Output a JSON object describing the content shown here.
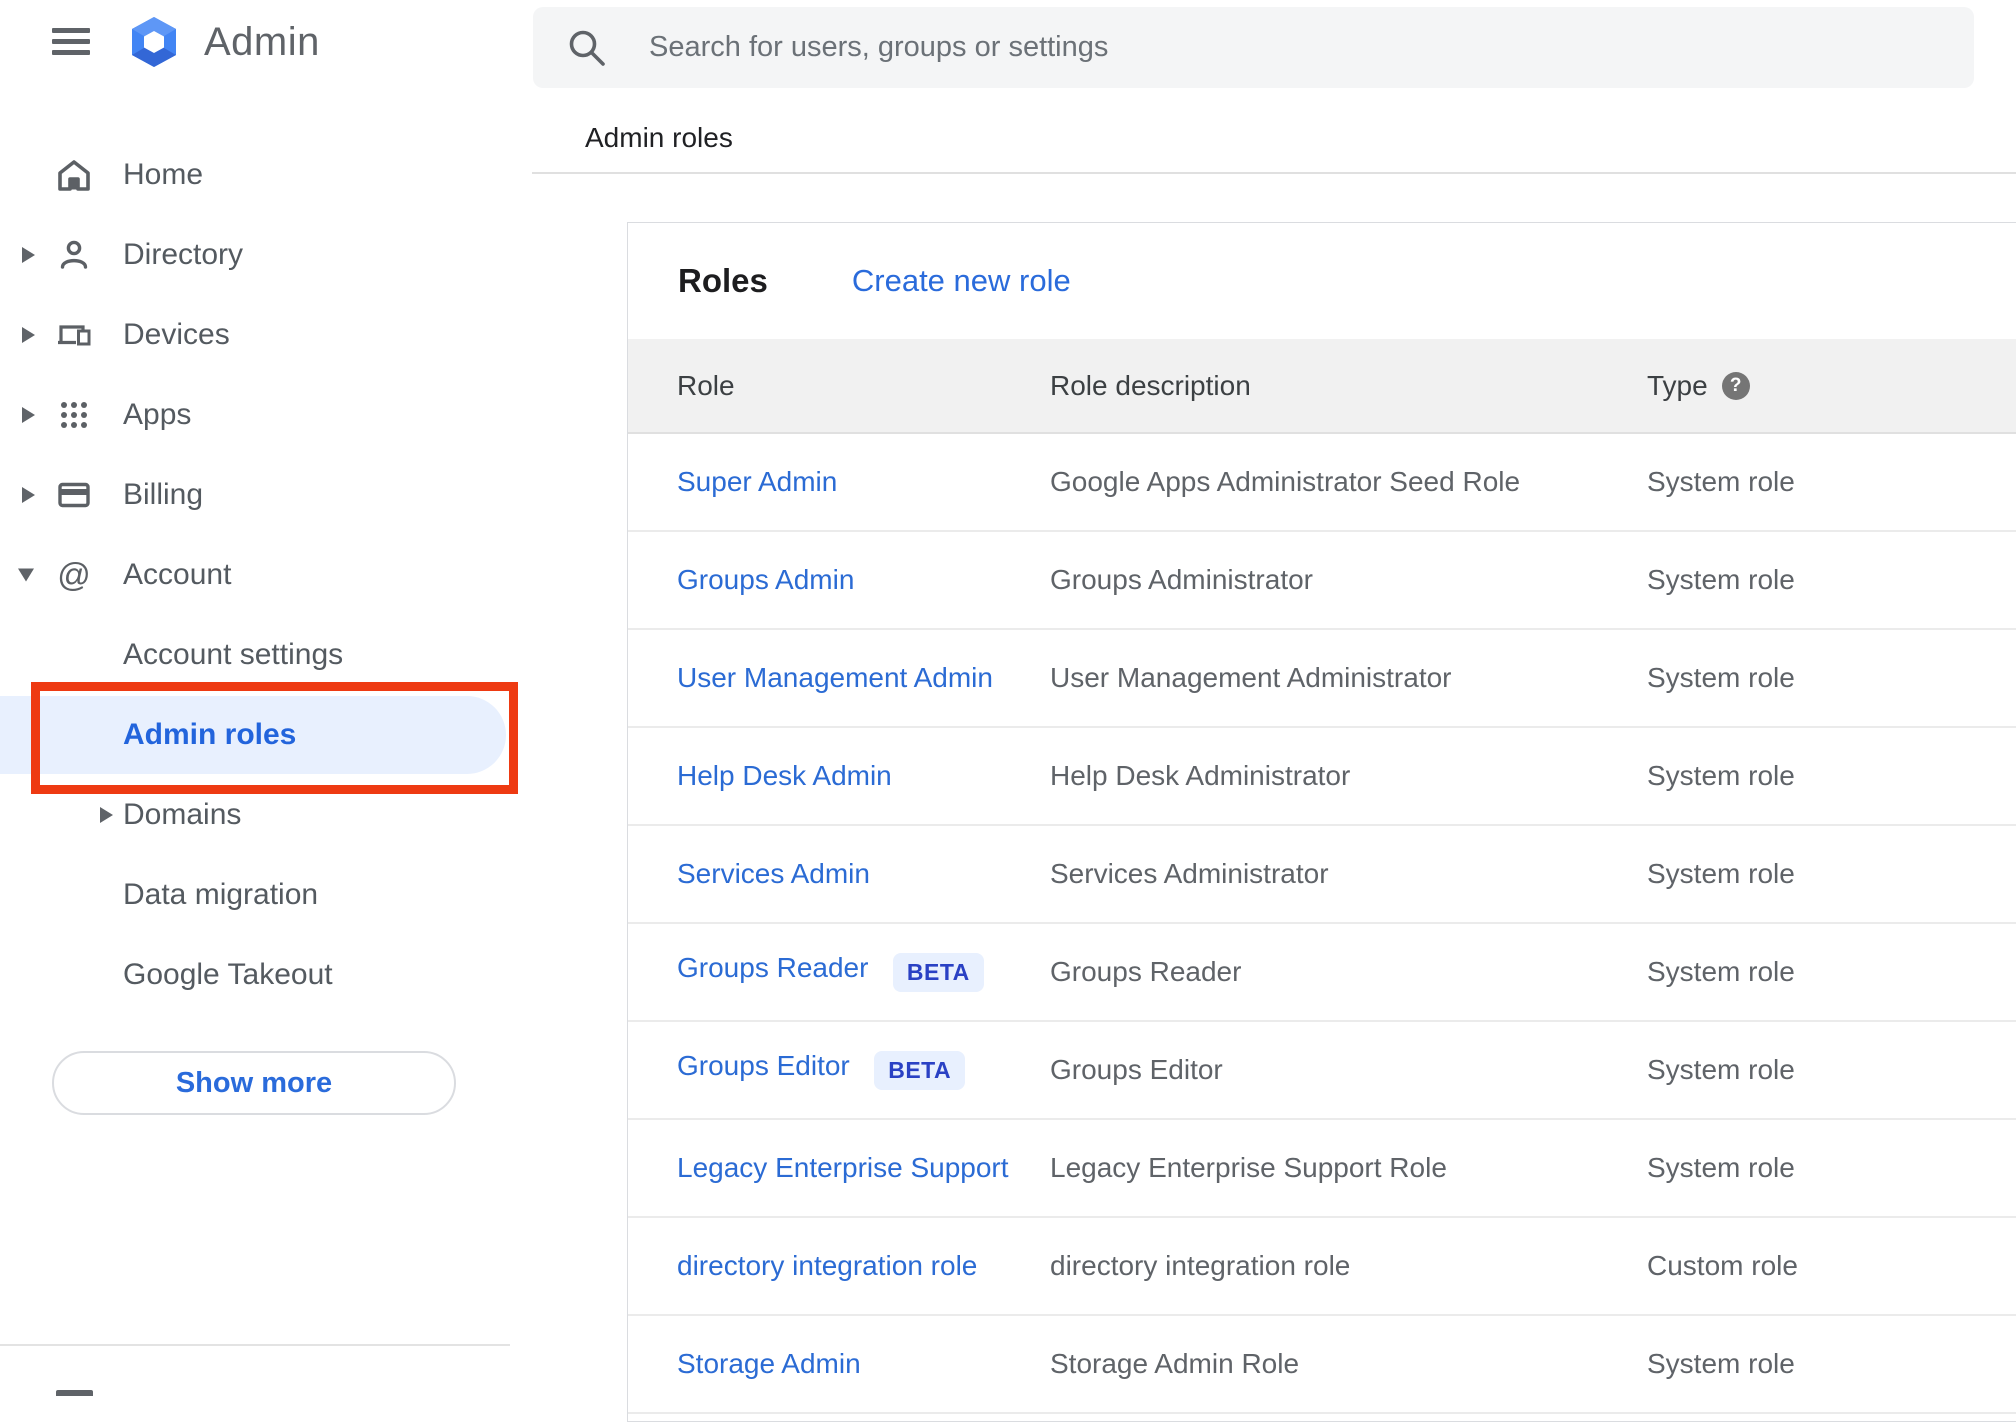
{
  "app": {
    "name": "Admin"
  },
  "search": {
    "placeholder": "Search for users, groups or settings"
  },
  "breadcrumb": "Admin roles",
  "sidebar": {
    "items": [
      {
        "label": "Home"
      },
      {
        "label": "Directory"
      },
      {
        "label": "Devices"
      },
      {
        "label": "Apps"
      },
      {
        "label": "Billing"
      },
      {
        "label": "Account"
      },
      {
        "label": "Account settings"
      },
      {
        "label": "Admin roles"
      },
      {
        "label": "Domains"
      },
      {
        "label": "Data migration"
      },
      {
        "label": "Google Takeout"
      }
    ],
    "show_more": "Show more"
  },
  "roles_card": {
    "title": "Roles",
    "create_link": "Create new role",
    "beta_label": "BETA",
    "columns": {
      "role": "Role",
      "description": "Role description",
      "type": "Type"
    },
    "rows": [
      {
        "role": "Super Admin",
        "description": "Google Apps Administrator Seed Role",
        "type": "System role"
      },
      {
        "role": "Groups Admin",
        "description": "Groups Administrator",
        "type": "System role"
      },
      {
        "role": "User Management Admin",
        "description": "User Management Administrator",
        "type": "System role"
      },
      {
        "role": "Help Desk Admin",
        "description": "Help Desk Administrator",
        "type": "System role"
      },
      {
        "role": "Services Admin",
        "description": "Services Administrator",
        "type": "System role"
      },
      {
        "role": "Groups Reader",
        "description": "Groups Reader",
        "type": "System role",
        "beta": true
      },
      {
        "role": "Groups Editor",
        "description": "Groups Editor",
        "type": "System role",
        "beta": true
      },
      {
        "role": "Legacy Enterprise Support",
        "description": "Legacy Enterprise Support Role",
        "type": "System role"
      },
      {
        "role": "directory integration role",
        "description": "directory integration role",
        "type": "Custom role"
      },
      {
        "role": "Storage Admin",
        "description": "Storage Admin Role",
        "type": "System role"
      }
    ]
  },
  "colors": {
    "accent_blue": "#2a6bdb",
    "link_blue": "#2b6bd4",
    "active_item_bg": "#e8f0fe",
    "active_item_text": "#2264dc",
    "beta_text": "#2a41c4",
    "beta_bg": "#e8f0fe",
    "annotation_red": "#ee3a12",
    "table_header_bg": "#f1f1f1",
    "search_bg": "#f4f5f6",
    "gray_text": "#5f6368",
    "logo_blue": "#4285f4"
  }
}
